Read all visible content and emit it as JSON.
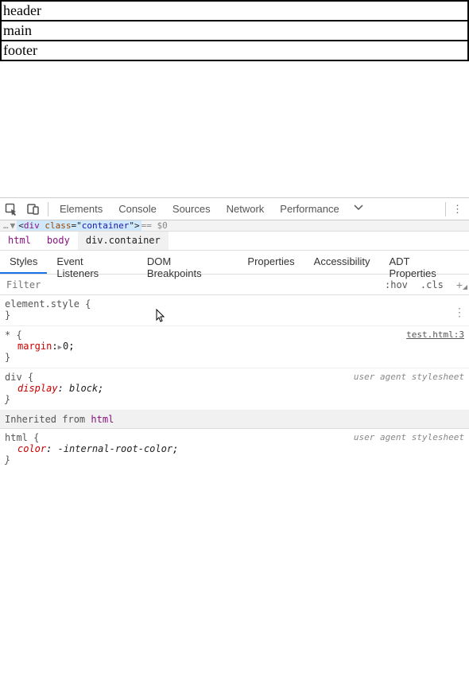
{
  "page": {
    "rows": [
      "header",
      "main",
      "footer"
    ]
  },
  "toolbar": {
    "tabs": [
      "Elements",
      "Console",
      "Sources",
      "Network",
      "Performance"
    ]
  },
  "elements_strip": {
    "prefix": "…",
    "tag": "div",
    "attr": "class",
    "val": "container",
    "suffix": " == $0"
  },
  "breadcrumb": {
    "items": [
      {
        "text": "html"
      },
      {
        "text": "body"
      },
      {
        "text": "div",
        "cls": ".container"
      }
    ]
  },
  "subtabs": [
    "Styles",
    "Event Listeners",
    "DOM Breakpoints",
    "Properties",
    "Accessibility",
    "ADT Properties"
  ],
  "filter": {
    "placeholder": "Filter",
    "hov": ":hov",
    "cls": ".cls"
  },
  "rules": {
    "element_style": {
      "selector": "element.style",
      "open": "{",
      "close": "}"
    },
    "universal": {
      "selector": "*",
      "open": "{",
      "close": "}",
      "origin": "test.html:3",
      "prop_name": "margin",
      "prop_value": "0"
    },
    "div": {
      "selector": "div",
      "open": "{",
      "close": "}",
      "origin": "user agent stylesheet",
      "prop_name": "display",
      "prop_value": "block"
    },
    "inherited_label": "Inherited from",
    "inherited_from": "html",
    "html": {
      "selector": "html",
      "open": "{",
      "close": "}",
      "origin": "user agent stylesheet",
      "prop_name": "color",
      "prop_value": "-internal-root-color"
    }
  }
}
